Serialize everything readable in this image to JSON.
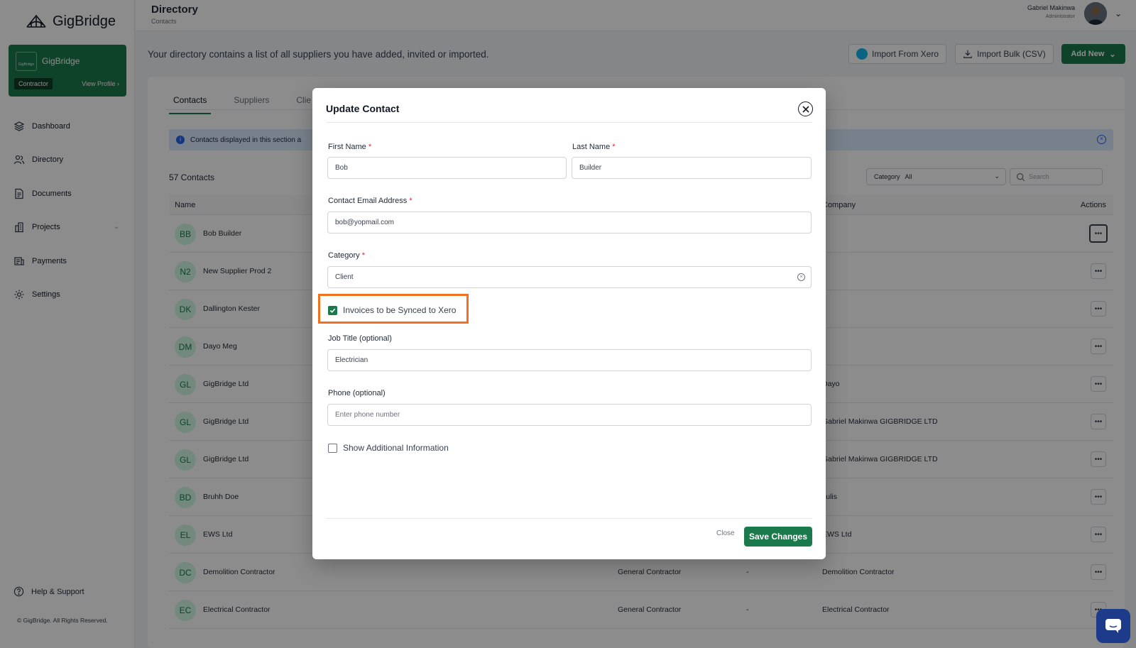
{
  "app": {
    "name": "GigBridge"
  },
  "profile_card": {
    "name": "GigBridge",
    "logo_text": "GigBridge",
    "role": "Contractor",
    "link": "View Profile"
  },
  "nav": {
    "items": [
      {
        "label": "Dashboard",
        "icon": "layers-icon"
      },
      {
        "label": "Directory",
        "icon": "users-icon"
      },
      {
        "label": "Documents",
        "icon": "document-icon"
      },
      {
        "label": "Projects",
        "icon": "building-icon"
      },
      {
        "label": "Payments",
        "icon": "payments-icon"
      },
      {
        "label": "Settings",
        "icon": "gear-icon"
      }
    ]
  },
  "help": {
    "label": "Help & Support"
  },
  "copyright": "© GigBridge. All Rights Reserved.",
  "header": {
    "title": "Directory",
    "breadcrumb": "Contacts"
  },
  "user": {
    "name": "Gabriel Makinwa",
    "role": "Administrator"
  },
  "page": {
    "description": "Your directory contains a list of all suppliers you have added, invited or imported.",
    "import_xero": "Import From Xero",
    "import_bulk": "Import Bulk (CSV)",
    "add_new": "Add New"
  },
  "tabs": [
    {
      "label": "Contacts",
      "active": true
    },
    {
      "label": "Suppliers",
      "active": false
    },
    {
      "label": "Clie",
      "active": false
    }
  ],
  "info_banner": {
    "text": "Contacts displayed in this section a"
  },
  "contacts": {
    "count_label": "57 Contacts",
    "category_filter_label": "Category",
    "category_filter_value": "All",
    "search_placeholder": "Search"
  },
  "table": {
    "columns": {
      "name": "Name",
      "company": "Company",
      "actions": "Actions"
    },
    "rows": [
      {
        "initials": "BB",
        "name": "Bob Builder",
        "type": "",
        "dash": "",
        "company": "-"
      },
      {
        "initials": "N2",
        "name": "New Supplier Prod 2",
        "type": "",
        "dash": "",
        "company": "-"
      },
      {
        "initials": "DK",
        "name": "Dallington Kester",
        "type": "",
        "dash": "",
        "company": "-"
      },
      {
        "initials": "DM",
        "name": "Dayo Meg",
        "type": "",
        "dash": "",
        "company": "-"
      },
      {
        "initials": "GL",
        "name": "GigBridge Ltd",
        "type": "",
        "dash": "",
        "company": "Dayo"
      },
      {
        "initials": "GL",
        "name": "GigBridge Ltd",
        "type": "",
        "dash": "",
        "company": "Gabriel Makinwa GIGBRIDGE LTD"
      },
      {
        "initials": "GL",
        "name": "GigBridge Ltd",
        "type": "",
        "dash": "",
        "company": "Gabriel Makinwa GIGBRIDGE LTD"
      },
      {
        "initials": "BD",
        "name": "Bruhh Doe",
        "type": "",
        "dash": "",
        "company": "Julis"
      },
      {
        "initials": "EL",
        "name": "EWS Ltd",
        "type": "",
        "dash": "",
        "company": "EWS Ltd"
      },
      {
        "initials": "DC",
        "name": "Demolition Contractor",
        "type": "General Contractor",
        "dash": "-",
        "company": "Demolition Contractor"
      },
      {
        "initials": "EC",
        "name": "Electrical Contractor",
        "type": "General Contractor",
        "dash": "-",
        "company": "Electrical Contractor"
      }
    ]
  },
  "modal": {
    "title": "Update Contact",
    "first_name": {
      "label": "First Name",
      "value": "Bob"
    },
    "last_name": {
      "label": "Last Name",
      "value": "Builder"
    },
    "email": {
      "label": "Contact Email Address",
      "value": "bob@yopmail.com"
    },
    "category": {
      "label": "Category",
      "value": "Client"
    },
    "sync_xero": {
      "label": "Invoices to be Synced to Xero",
      "checked": true
    },
    "job_title": {
      "label": "Job Title (optional)",
      "value": "Electrician"
    },
    "phone": {
      "label": "Phone (optional)",
      "placeholder": "Enter phone number"
    },
    "additional": {
      "label": "Show Additional Information",
      "checked": false
    },
    "close_label": "Close",
    "save_label": "Save Changes"
  },
  "colors": {
    "brand": "#1a7a4c",
    "highlight": "#f2711c",
    "info_bg": "#dbeafe",
    "chat": "#1e3a8a"
  }
}
